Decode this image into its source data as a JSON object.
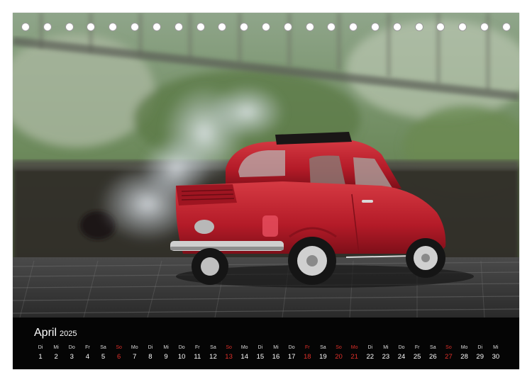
{
  "calendar": {
    "month": "April",
    "year": "2025",
    "days": [
      {
        "wd": "Di",
        "d": "1",
        "red": false
      },
      {
        "wd": "Mi",
        "d": "2",
        "red": false
      },
      {
        "wd": "Do",
        "d": "3",
        "red": false
      },
      {
        "wd": "Fr",
        "d": "4",
        "red": false
      },
      {
        "wd": "Sa",
        "d": "5",
        "red": false
      },
      {
        "wd": "So",
        "d": "6",
        "red": true
      },
      {
        "wd": "Mo",
        "d": "7",
        "red": false
      },
      {
        "wd": "Di",
        "d": "8",
        "red": false
      },
      {
        "wd": "Mi",
        "d": "9",
        "red": false
      },
      {
        "wd": "Do",
        "d": "10",
        "red": false
      },
      {
        "wd": "Fr",
        "d": "11",
        "red": false
      },
      {
        "wd": "Sa",
        "d": "12",
        "red": false
      },
      {
        "wd": "So",
        "d": "13",
        "red": true
      },
      {
        "wd": "Mo",
        "d": "14",
        "red": false
      },
      {
        "wd": "Di",
        "d": "15",
        "red": false
      },
      {
        "wd": "Mi",
        "d": "16",
        "red": false
      },
      {
        "wd": "Do",
        "d": "17",
        "red": false
      },
      {
        "wd": "Fr",
        "d": "18",
        "red": true
      },
      {
        "wd": "Sa",
        "d": "19",
        "red": false
      },
      {
        "wd": "So",
        "d": "20",
        "red": true
      },
      {
        "wd": "Mo",
        "d": "21",
        "red": true
      },
      {
        "wd": "Di",
        "d": "22",
        "red": false
      },
      {
        "wd": "Mi",
        "d": "23",
        "red": false
      },
      {
        "wd": "Do",
        "d": "24",
        "red": false
      },
      {
        "wd": "Fr",
        "d": "25",
        "red": false
      },
      {
        "wd": "Sa",
        "d": "26",
        "red": false
      },
      {
        "wd": "So",
        "d": "27",
        "red": true
      },
      {
        "wd": "Mo",
        "d": "28",
        "red": false
      },
      {
        "wd": "Di",
        "d": "29",
        "red": false
      },
      {
        "wd": "Mi",
        "d": "30",
        "red": false
      }
    ]
  },
  "colors": {
    "background": "#000000",
    "weekday_text": "#dddddd",
    "date_text": "#ffffff",
    "holiday": "#e0302a",
    "car": "#c0202e"
  },
  "binding_holes": 23
}
